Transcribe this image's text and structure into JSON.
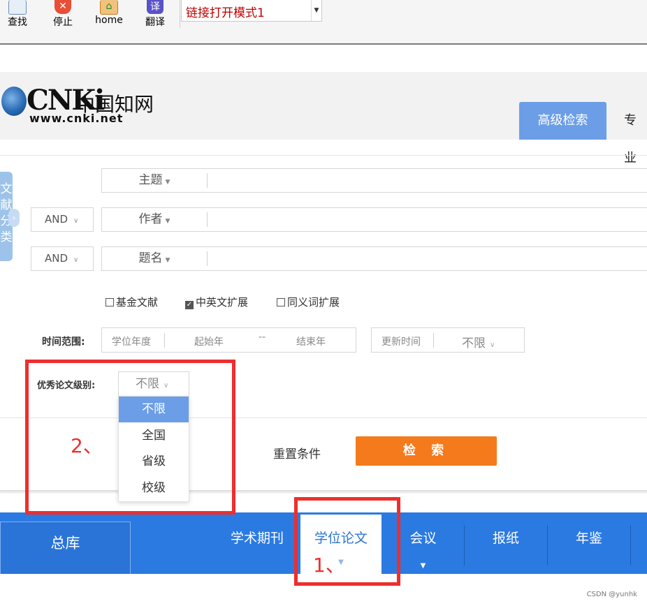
{
  "toolbar": {
    "buttons": [
      {
        "label": "查找",
        "icon": "search-icon"
      },
      {
        "label": "停止",
        "icon": "stop-icon"
      },
      {
        "label": "home",
        "icon": "home-icon"
      },
      {
        "label": "翻译",
        "icon": "translate-icon"
      }
    ],
    "stop_glyph": "✕",
    "home_glyph": "⌂",
    "translate_glyph": "译",
    "mode_select_value": "链接打开模式1"
  },
  "header": {
    "logo_text": "CNKi",
    "logo_cn": "中国知网",
    "logo_url": "www.cnki.net",
    "tabs": [
      "高级检索",
      "专业"
    ]
  },
  "side_tab": {
    "label": "文献分类",
    "chevron": "›"
  },
  "search_rows": [
    {
      "logic": "",
      "field": "主题"
    },
    {
      "logic": "AND",
      "field": "作者"
    },
    {
      "logic": "AND",
      "field": "题名"
    }
  ],
  "options": [
    {
      "label": "基金文献",
      "checked": false
    },
    {
      "label": "中英文扩展",
      "checked": true
    },
    {
      "label": "同义词扩展",
      "checked": false
    }
  ],
  "time_range": {
    "label": "时间范围:",
    "type": "学位年度",
    "start_placeholder": "起始年",
    "separator": "--",
    "end_placeholder": "结束年",
    "update_label": "更新时间",
    "update_value": "不限"
  },
  "excellence": {
    "label": "优秀论文级别:",
    "value": "不限",
    "options": [
      "不限",
      "全国",
      "省级",
      "校级"
    ],
    "selected_index": 0
  },
  "actions": {
    "reset": "重置条件",
    "search": "检 索"
  },
  "bottom_nav": {
    "total": "总库",
    "items": [
      "学术期刊",
      "学位论文",
      "会议",
      "报纸",
      "年鉴"
    ],
    "active": "学位论文"
  },
  "annotations": {
    "one": "1、",
    "two": "2、"
  },
  "watermark": "CSDN @yunhk",
  "colors": {
    "accent": "#6b9ee6",
    "search_button": "#f47a1c",
    "nav_bar": "#2a7ae2",
    "annotation": "#ee2e2e"
  }
}
